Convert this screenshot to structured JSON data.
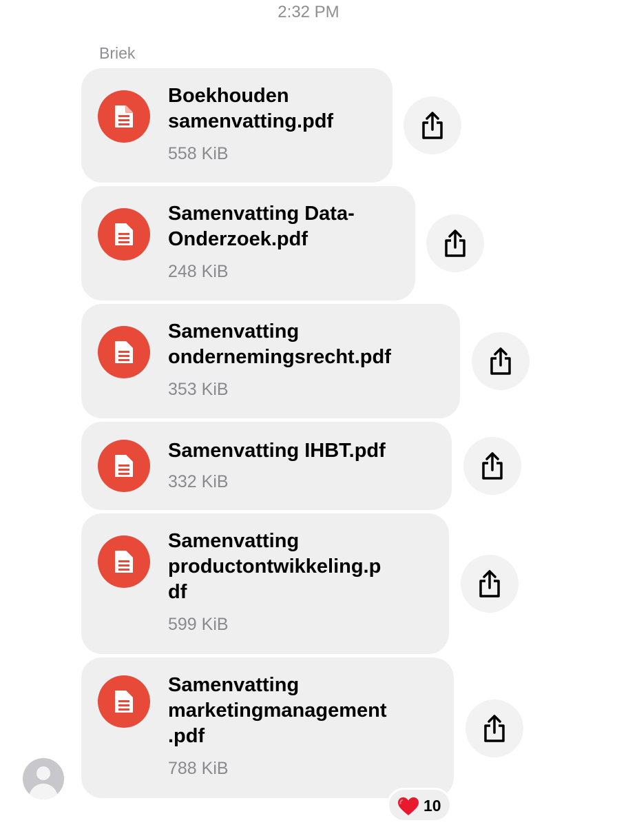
{
  "timestamp": "2:32 PM",
  "sender": "Briek",
  "files": [
    {
      "name": "Boekhouden\nsamenvatting.pdf",
      "size": "558 KiB"
    },
    {
      "name": "Samenvatting Data-\nOnderzoek.pdf",
      "size": "248 KiB"
    },
    {
      "name": "Samenvatting\nondernemingsrecht.pdf",
      "size": "353 KiB"
    },
    {
      "name": "Samenvatting IHBT.pdf",
      "size": "332 KiB"
    },
    {
      "name": "Samenvatting\nproductontwikkeling.p\ndf",
      "size": "599 KiB"
    },
    {
      "name": "Samenvatting\nmarketingmanagement\n.pdf",
      "size": "788 KiB"
    }
  ],
  "reaction": {
    "emoji": "heart",
    "count": "10"
  },
  "colors": {
    "file_icon": "#e84a3a",
    "bubble": "#efefef",
    "muted_text": "#8e8e93"
  },
  "icons": {
    "file": "document-icon",
    "share": "share-icon",
    "avatar": "person-icon"
  }
}
